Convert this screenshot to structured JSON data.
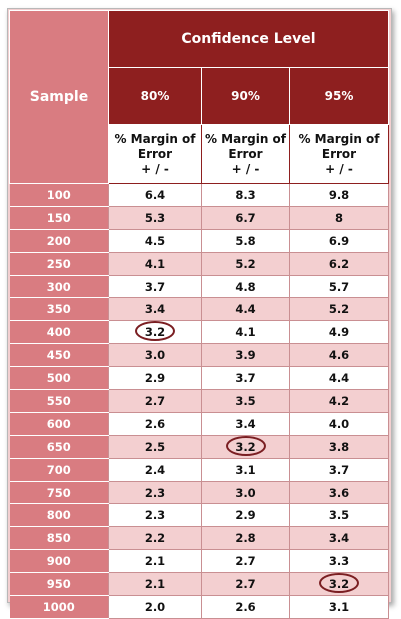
{
  "headers": {
    "sample": "Sample",
    "confidence_level": "Confidence Level",
    "levels": [
      "80%",
      "90%",
      "95%"
    ],
    "margin_label": [
      "% Margin of",
      "Error",
      "+ / -"
    ]
  },
  "rows": [
    {
      "sample": "100",
      "v80": "6.4",
      "v90": "8.3",
      "v95": "9.8"
    },
    {
      "sample": "150",
      "v80": "5.3",
      "v90": "6.7",
      "v95": "8"
    },
    {
      "sample": "200",
      "v80": "4.5",
      "v90": "5.8",
      "v95": "6.9"
    },
    {
      "sample": "250",
      "v80": "4.1",
      "v90": "5.2",
      "v95": "6.2"
    },
    {
      "sample": "300",
      "v80": "3.7",
      "v90": "4.8",
      "v95": "5.7"
    },
    {
      "sample": "350",
      "v80": "3.4",
      "v90": "4.4",
      "v95": "5.2"
    },
    {
      "sample": "400",
      "v80": "3.2",
      "v90": "4.1",
      "v95": "4.9"
    },
    {
      "sample": "450",
      "v80": "3.0",
      "v90": "3.9",
      "v95": "4.6"
    },
    {
      "sample": "500",
      "v80": "2.9",
      "v90": "3.7",
      "v95": "4.4"
    },
    {
      "sample": "550",
      "v80": "2.7",
      "v90": "3.5",
      "v95": "4.2"
    },
    {
      "sample": "600",
      "v80": "2.6",
      "v90": "3.4",
      "v95": "4.0"
    },
    {
      "sample": "650",
      "v80": "2.5",
      "v90": "3.2",
      "v95": "3.8"
    },
    {
      "sample": "700",
      "v80": "2.4",
      "v90": "3.1",
      "v95": "3.7"
    },
    {
      "sample": "750",
      "v80": "2.3",
      "v90": "3.0",
      "v95": "3.6"
    },
    {
      "sample": "800",
      "v80": "2.3",
      "v90": "2.9",
      "v95": "3.5"
    },
    {
      "sample": "850",
      "v80": "2.2",
      "v90": "2.8",
      "v95": "3.4"
    },
    {
      "sample": "900",
      "v80": "2.1",
      "v90": "2.7",
      "v95": "3.3"
    },
    {
      "sample": "950",
      "v80": "2.1",
      "v90": "2.7",
      "v95": "3.2"
    },
    {
      "sample": "1000",
      "v80": "2.0",
      "v90": "2.6",
      "v95": "3.1"
    }
  ],
  "highlighted": [
    {
      "sample": "400",
      "level": "80%"
    },
    {
      "sample": "650",
      "level": "90%"
    },
    {
      "sample": "950",
      "level": "95%"
    }
  ],
  "colors": {
    "header_dark_red": "#8e1f1f",
    "sample_column_pink": "#d97c81",
    "stripe_pink": "#f3cfd0",
    "highlight_ring": "#7a1e22"
  }
}
